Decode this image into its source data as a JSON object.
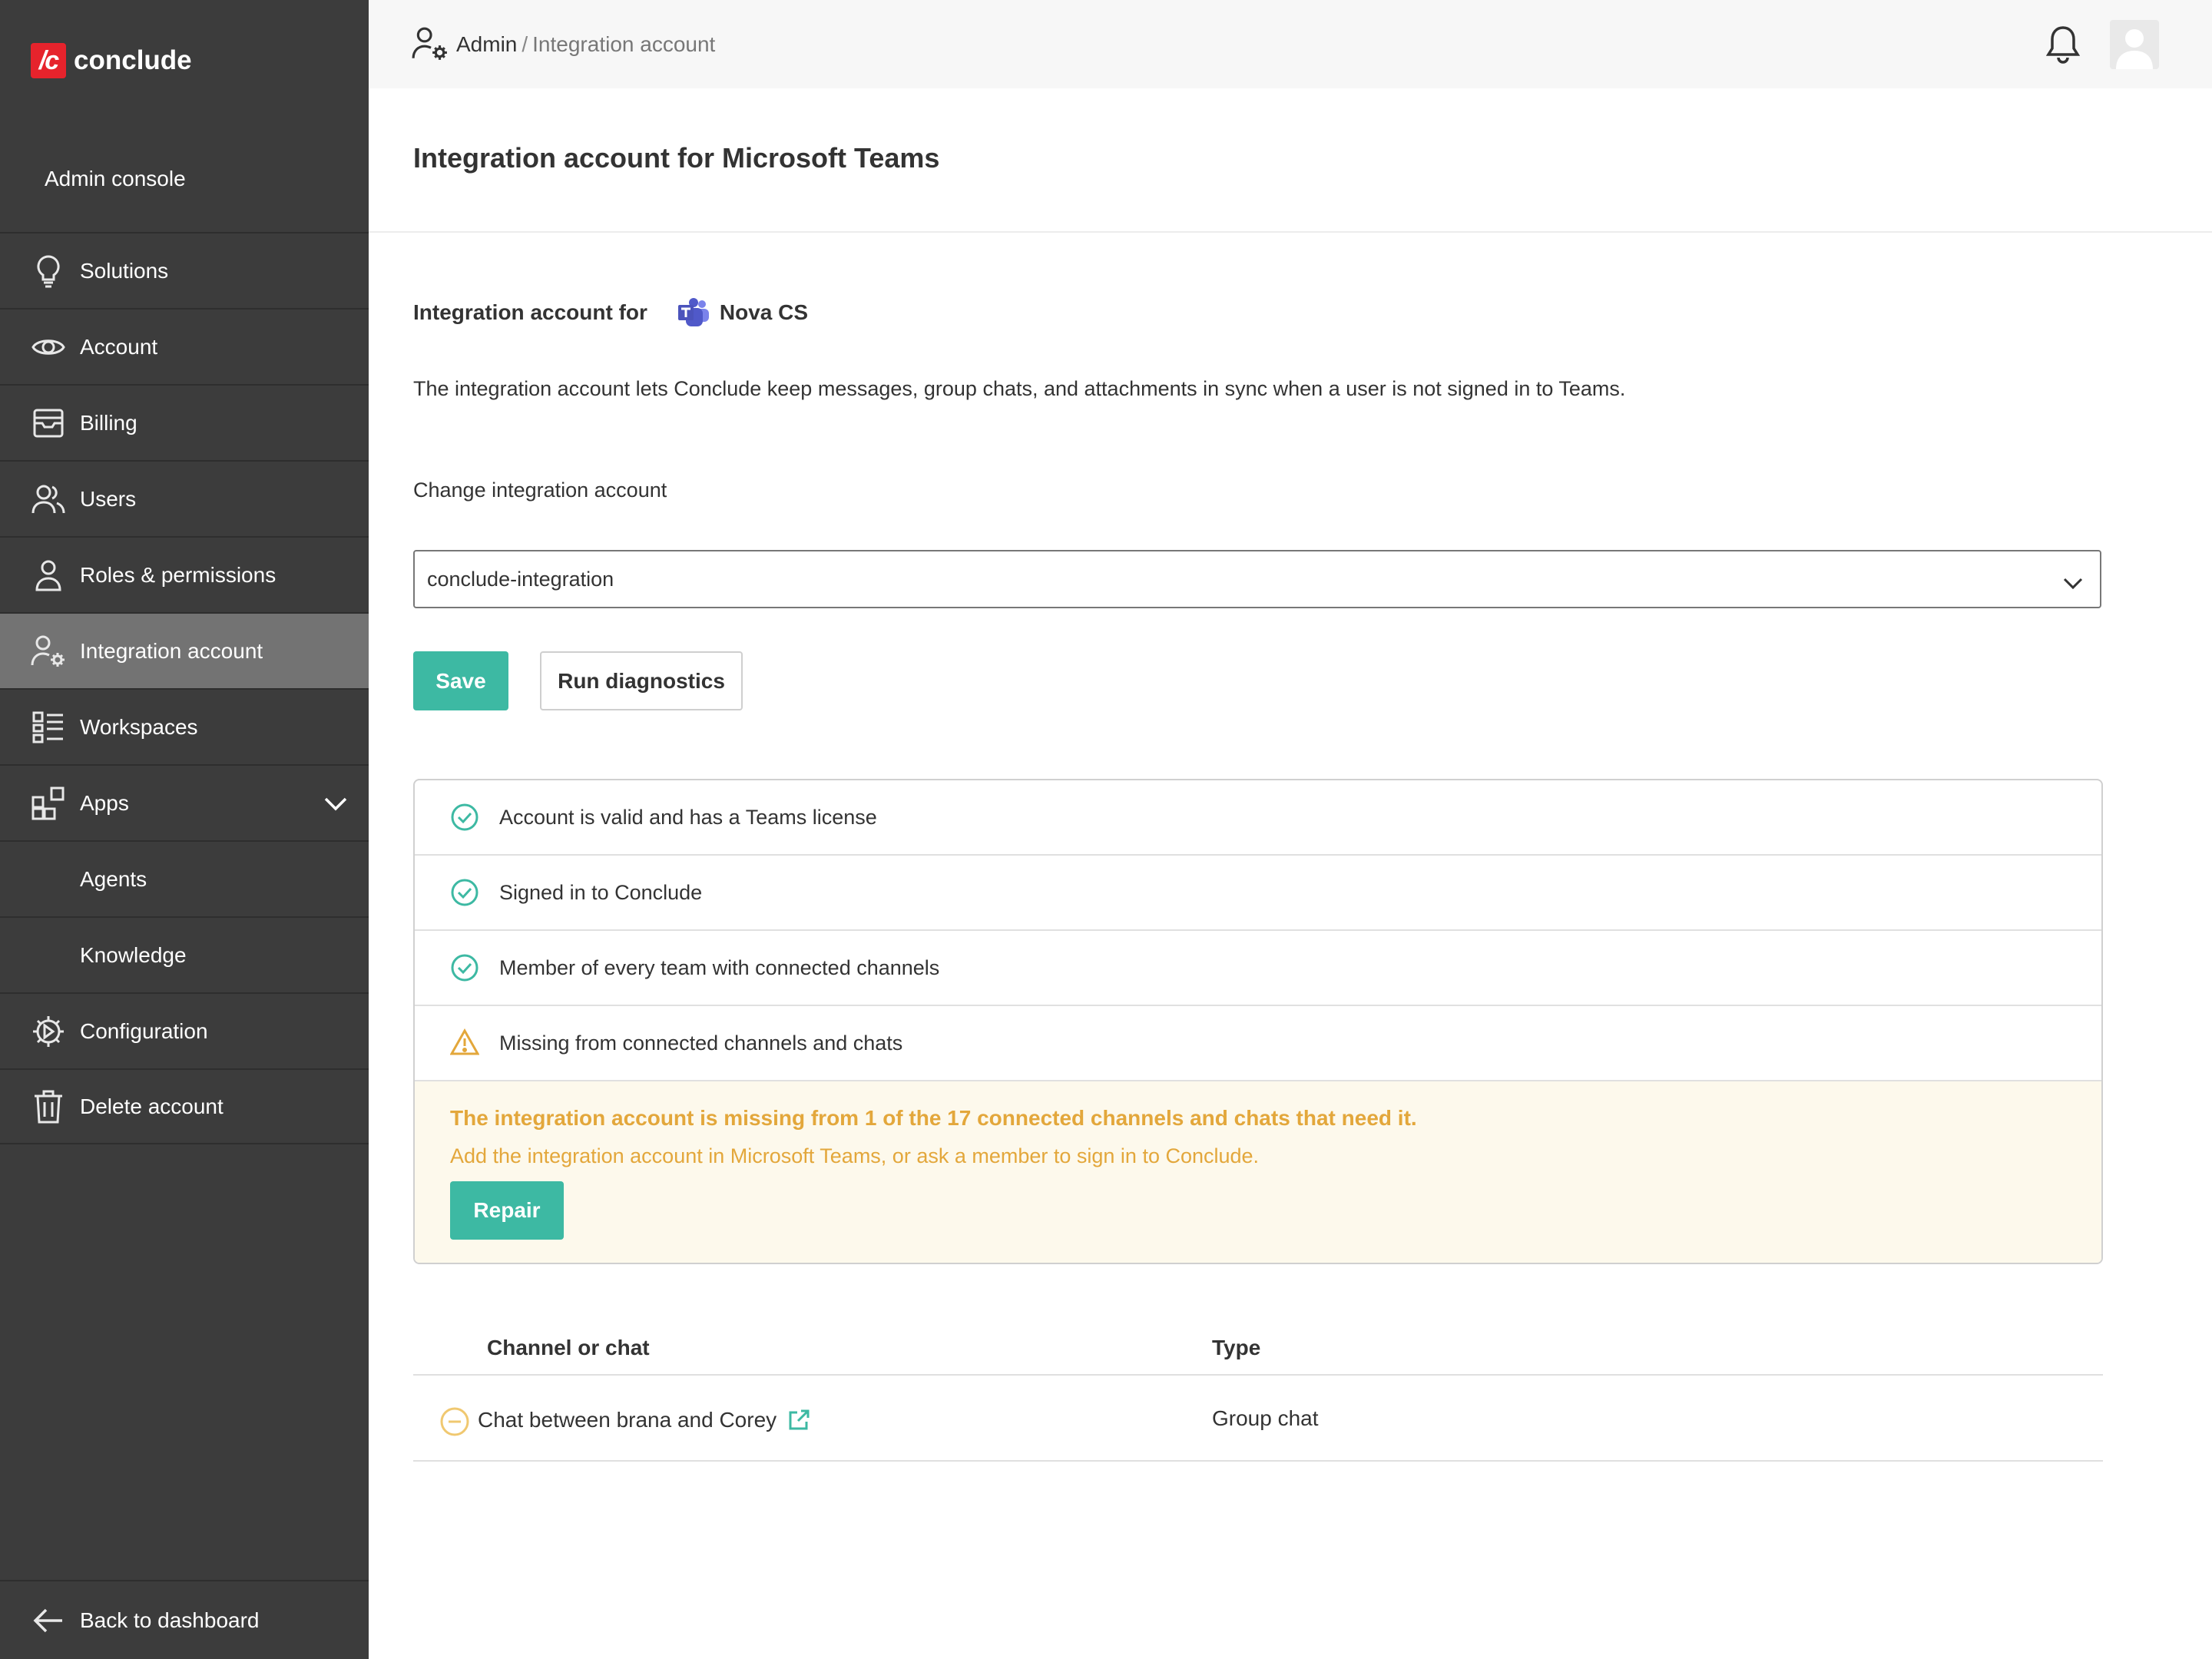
{
  "brand": {
    "logo_mark": "/c",
    "name": "conclude",
    "accent": "#e6232c"
  },
  "sidebar": {
    "title": "Admin console",
    "items": [
      {
        "label": "Solutions",
        "icon": "lightbulb-icon"
      },
      {
        "label": "Account",
        "icon": "eye-icon"
      },
      {
        "label": "Billing",
        "icon": "billing-icon"
      },
      {
        "label": "Users",
        "icon": "users-icon"
      },
      {
        "label": "Roles & permissions",
        "icon": "user-icon"
      },
      {
        "label": "Integration account",
        "icon": "user-gear-icon",
        "active": true
      },
      {
        "label": "Workspaces",
        "icon": "list-icon"
      },
      {
        "label": "Apps",
        "icon": "apps-icon",
        "expanded": true
      },
      {
        "label": "Agents",
        "sub": true
      },
      {
        "label": "Knowledge",
        "sub": true
      },
      {
        "label": "Configuration",
        "icon": "gear-icon"
      },
      {
        "label": "Delete account",
        "icon": "trash-icon"
      }
    ],
    "back_label": "Back to dashboard"
  },
  "breadcrumb": {
    "root": "Admin",
    "separator": "/",
    "current": "Integration account"
  },
  "page": {
    "title": "Integration account for Microsoft Teams",
    "for_label": "Integration account for",
    "org_name": "Nova CS",
    "description": "The integration account lets Conclude keep messages, group chats, and attachments in sync when a user is not signed in to Teams.",
    "change_label": "Change integration account",
    "selected_account": "conclude-integration",
    "save_label": "Save",
    "diagnostics_label": "Run diagnostics"
  },
  "checks": [
    {
      "label": "Account is valid and has a Teams license",
      "status": "ok"
    },
    {
      "label": "Signed in to Conclude",
      "status": "ok"
    },
    {
      "label": "Member of every team with connected channels",
      "status": "ok"
    },
    {
      "label": "Missing from connected channels and chats",
      "status": "warning"
    }
  ],
  "warning": {
    "title": "The integration account is missing from 1 of the 17 connected channels and chats that need it.",
    "text": "Add the integration account in Microsoft Teams, or ask a member to sign in to Conclude.",
    "repair_label": "Repair"
  },
  "table": {
    "headers": [
      "Channel or chat",
      "Type"
    ],
    "rows": [
      {
        "name": "Chat between brana and Corey",
        "type": "Group chat"
      }
    ]
  },
  "colors": {
    "teal": "#3db9a3",
    "warning": "#e3a73b",
    "sidebar": "#3c3c3c",
    "sidebar_active": "#737373"
  }
}
